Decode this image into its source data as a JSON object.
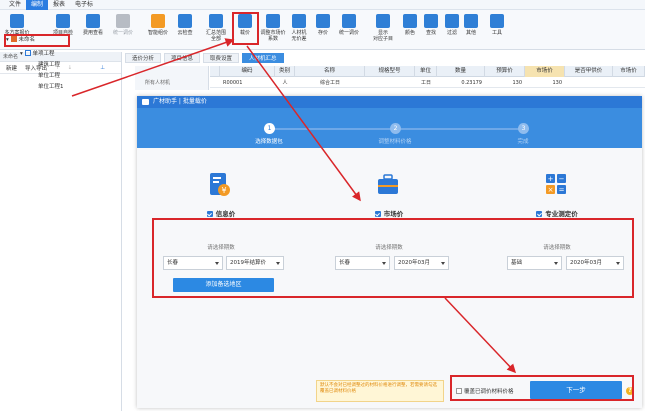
{
  "menu": {
    "items": [
      "文件",
      "编制",
      "报表",
      "电子标"
    ]
  },
  "ribbon": {
    "buttons": [
      {
        "label": "多方案报价",
        "sub": ""
      },
      {
        "label": "项目自检",
        "sub": ""
      },
      {
        "label": "费用查看",
        "sub": ""
      },
      {
        "label": "统一调价",
        "sub": ""
      },
      {
        "label": "智能组价",
        "sub": ""
      },
      {
        "label": "云检查",
        "sub": ""
      },
      {
        "label": "汇总范围",
        "sub": "全部"
      },
      {
        "label": "载价",
        "sub": ""
      },
      {
        "label": "调整市场价",
        "sub": "系数"
      },
      {
        "label": "人材机",
        "sub": "无价差"
      },
      {
        "label": "存价",
        "sub": ""
      },
      {
        "label": "统一调价",
        "sub": ""
      },
      {
        "label": "显示",
        "sub": "对应子目"
      },
      {
        "label": "颜色",
        "sub": ""
      },
      {
        "label": "查找",
        "sub": ""
      },
      {
        "label": "过滤",
        "sub": ""
      },
      {
        "label": "其他",
        "sub": ""
      },
      {
        "label": "工具",
        "sub": ""
      }
    ]
  },
  "left_panel": {
    "header": "未命名",
    "tools": {
      "new": "新建",
      "import_export": "导入导出"
    },
    "tree": [
      {
        "label": "未命名",
        "level": 0
      },
      {
        "label": "单项工程",
        "level": 1
      },
      {
        "label": "建筑工程",
        "level": 2
      },
      {
        "label": "单位工程",
        "level": 2
      },
      {
        "label": "单位工程1",
        "level": 2
      }
    ]
  },
  "tabs": [
    "造价分析",
    "项目信息",
    "取费设置",
    "人材机汇总"
  ],
  "side_grid": {
    "label": "所有人材机"
  },
  "grid": {
    "columns": [
      "编码",
      "类别",
      "名称",
      "规格型号",
      "单位",
      "数量",
      "预算价",
      "市场价",
      "是否甲供价",
      "市场价"
    ],
    "rows": [
      [
        "R00001",
        "人",
        "综合工日",
        "",
        "工日",
        "0.23179",
        "130",
        "130",
        "",
        ""
      ]
    ]
  },
  "dialog": {
    "title": "广材助手 | 批量载价",
    "steps": [
      {
        "num": "1",
        "label": "选择数据包"
      },
      {
        "num": "2",
        "label": "调整材料价格"
      },
      {
        "num": "3",
        "label": "完成"
      }
    ],
    "columns": [
      {
        "title": "信息价",
        "period_label": "请选择期数",
        "region": "长春",
        "period": "2019年结算价",
        "add_button": "添加备选地区"
      },
      {
        "title": "市场价",
        "period_label": "请选择期数",
        "region": "长春",
        "period": "2020年03月"
      },
      {
        "title": "专业测定价",
        "period_label": "请选择期数",
        "region": "基础",
        "period": "2020年03月"
      }
    ],
    "warning": "默认不会对已经调整过的材料价格进行调整，若需要请勾选覆盖已调材料价格",
    "overwrite_label": "覆盖已调价材料价格",
    "next_button": "下一步",
    "help": "?"
  },
  "colors": {
    "accent": "#2c78d6",
    "annotation_red": "#d9262a",
    "warning_bg": "#fff6d6"
  }
}
